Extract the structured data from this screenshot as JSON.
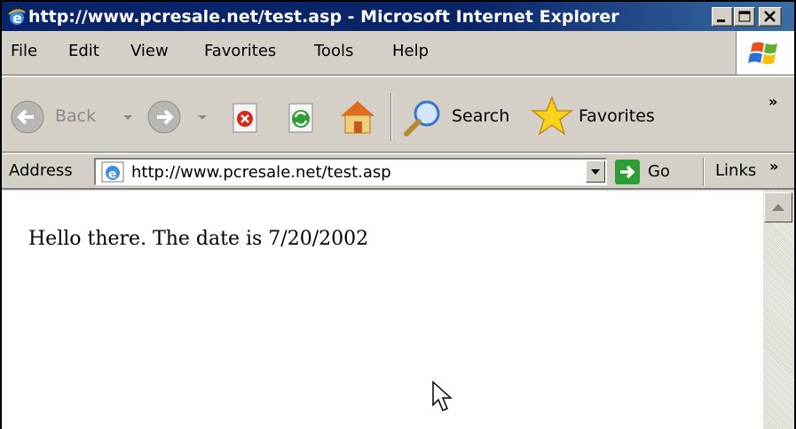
{
  "window": {
    "title": "http://www.pcresale.net/test.asp - Microsoft Internet Explorer"
  },
  "menu": {
    "items": [
      "File",
      "Edit",
      "View",
      "Favorites",
      "Tools",
      "Help"
    ]
  },
  "toolbar": {
    "back_label": "Back",
    "search_label": "Search",
    "favorites_label": "Favorites",
    "overflow_label": "»"
  },
  "address": {
    "label": "Address",
    "url": "http://www.pcresale.net/test.asp",
    "go_label": "Go",
    "links_label": "Links",
    "links_overflow": "»"
  },
  "page": {
    "text": "Hello there. The date is 7/20/2002"
  },
  "colors": {
    "titlebar": "#0a246a",
    "chrome": "#d4d0c8",
    "go_green": "#2e9e34"
  }
}
